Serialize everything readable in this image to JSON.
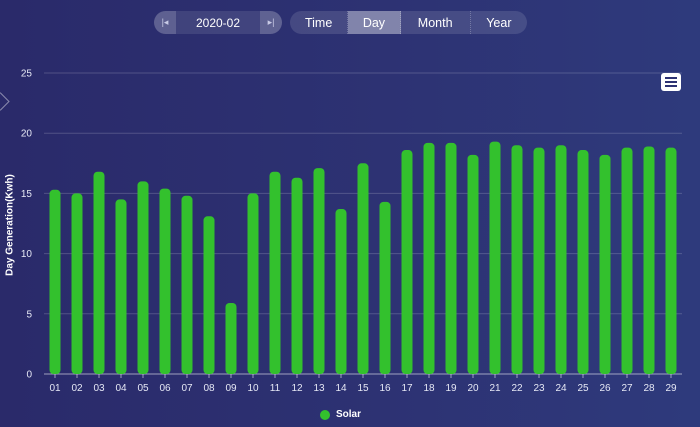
{
  "controls": {
    "prev_icon": "|◂",
    "next_icon": "▸|",
    "date_value": "2020-02",
    "tabs": [
      {
        "label": "Time"
      },
      {
        "label": "Day",
        "active": true
      },
      {
        "label": "Month"
      },
      {
        "label": "Year"
      }
    ]
  },
  "chart_data": {
    "type": "bar",
    "ylabel": "Day Generation(Kwh)",
    "ylim": [
      0,
      25
    ],
    "yticks": [
      0,
      5,
      10,
      15,
      20,
      25
    ],
    "grid": true,
    "legend_position": "bottom-center",
    "categories": [
      "01",
      "02",
      "03",
      "04",
      "05",
      "06",
      "07",
      "08",
      "09",
      "10",
      "11",
      "12",
      "13",
      "14",
      "15",
      "16",
      "17",
      "18",
      "19",
      "20",
      "21",
      "22",
      "23",
      "24",
      "25",
      "26",
      "27",
      "28",
      "29"
    ],
    "series": [
      {
        "name": "Solar",
        "color": "#33c12d",
        "values": [
          15.3,
          15.0,
          16.8,
          14.5,
          16.0,
          15.4,
          14.8,
          13.1,
          5.9,
          15.0,
          16.8,
          16.3,
          17.1,
          13.7,
          17.5,
          14.3,
          18.6,
          19.2,
          19.2,
          18.2,
          19.3,
          19.0,
          18.8,
          19.0,
          18.6,
          18.2,
          18.8,
          18.9,
          18.8
        ]
      }
    ]
  }
}
